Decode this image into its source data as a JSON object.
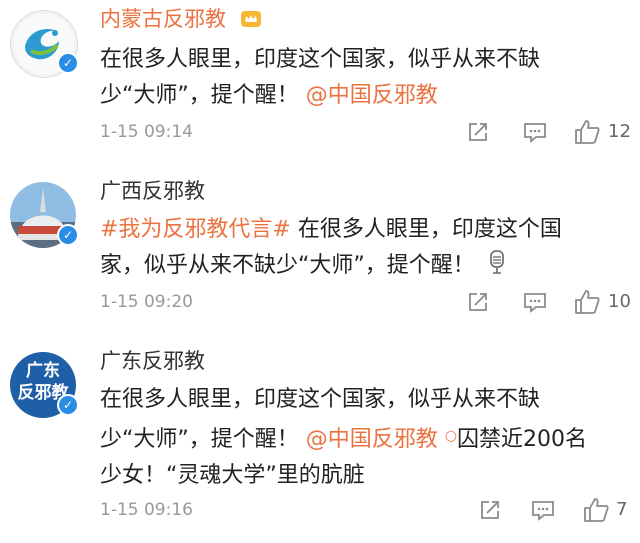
{
  "posts": [
    {
      "name": "内蒙古反邪教",
      "text": [
        "在很多人眼里，印度这个国家，似乎从来不缺",
        "少“大师”，提个醒！"
      ],
      "mention": "@中国反邪教",
      "time": "1-15 09:14",
      "likes": "12"
    },
    {
      "name": "广西反邪教",
      "hashtag": "#我为反邪教代言#",
      "text": [
        " 在很多人眼里，印度这个国",
        "家，似乎从来不缺少“大师”，提个醒！"
      ],
      "time": "1-15 09:20",
      "likes": "10"
    },
    {
      "name": "广东反邪教",
      "avatar_text": [
        "广东",
        "反邪教"
      ],
      "text": [
        "在很多人眼里，印度这个国家，似乎从来不缺",
        "少“大师”，提个醒！"
      ],
      "mention": "@中国反邪教",
      "link_title": "囚禁近200名",
      "text3": "少女！“灵魂大学”里的肮脏",
      "time": "1-15 09:16",
      "likes": "7"
    }
  ],
  "colors": {
    "link": "#eb7340",
    "verified": "#2a8de5",
    "meta": "#999999"
  }
}
